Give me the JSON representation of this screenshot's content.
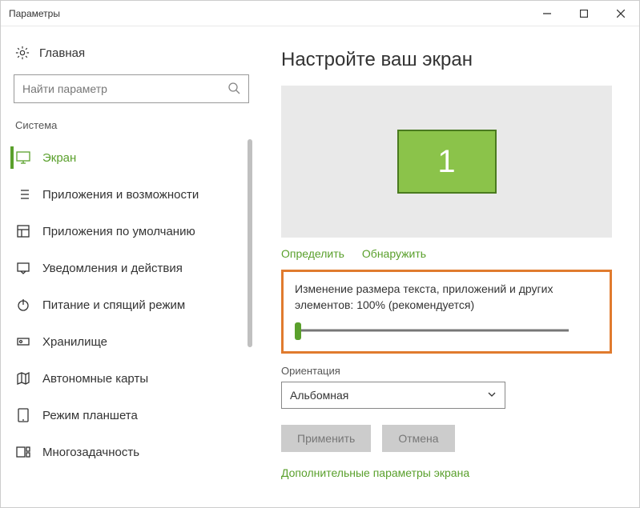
{
  "window": {
    "title": "Параметры"
  },
  "sidebar": {
    "home": "Главная",
    "search_placeholder": "Найти параметр",
    "section": "Система",
    "items": [
      {
        "label": "Экран",
        "icon": "monitor",
        "active": true
      },
      {
        "label": "Приложения и возможности",
        "icon": "list"
      },
      {
        "label": "Приложения по умолчанию",
        "icon": "defaults"
      },
      {
        "label": "Уведомления и действия",
        "icon": "notify"
      },
      {
        "label": "Питание и спящий режим",
        "icon": "power"
      },
      {
        "label": "Хранилище",
        "icon": "storage"
      },
      {
        "label": "Автономные карты",
        "icon": "map"
      },
      {
        "label": "Режим планшета",
        "icon": "tablet"
      },
      {
        "label": "Многозадачность",
        "icon": "multitask"
      }
    ]
  },
  "main": {
    "heading": "Настройте ваш экран",
    "monitor_number": "1",
    "link_identify": "Определить",
    "link_detect": "Обнаружить",
    "scale_label": "Изменение размера текста, приложений и других элементов: 100% (рекомендуется)",
    "orientation_label": "Ориентация",
    "orientation_value": "Альбомная",
    "btn_apply": "Применить",
    "btn_cancel": "Отмена",
    "advanced_link": "Дополнительные параметры экрана"
  },
  "colors": {
    "accent": "#5aa02c",
    "highlight_border": "#e07b2e"
  }
}
